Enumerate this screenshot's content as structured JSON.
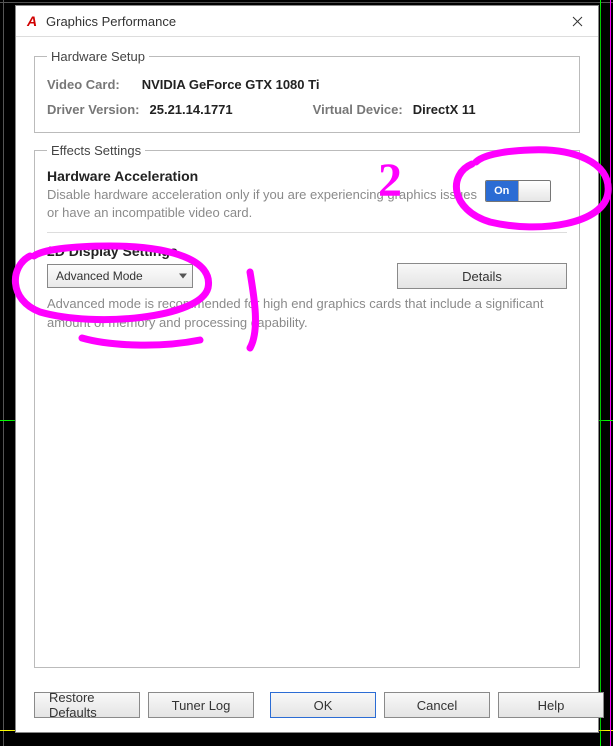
{
  "window": {
    "title": "Graphics Performance"
  },
  "hardware": {
    "legend": "Hardware Setup",
    "video_card_label": "Video Card:",
    "video_card_value": "NVIDIA GeForce GTX 1080 Ti",
    "driver_label": "Driver Version:",
    "driver_value": "25.21.14.1771",
    "virtual_device_label": "Virtual Device:",
    "virtual_device_value": "DirectX 11"
  },
  "effects": {
    "legend": "Effects Settings",
    "hw_accel_title": "Hardware Acceleration",
    "hw_accel_desc": "Disable hardware acceleration only if you are experiencing graphics issues or have an incompatible video card.",
    "toggle_on_label": "On",
    "twod_title": "2D Display Settings",
    "mode_selected": "Advanced Mode",
    "details_label": "Details",
    "twod_desc": "Advanced mode is recommended for high end graphics cards that include a significant amount of memory and processing capability."
  },
  "footer": {
    "restore": "Restore Defaults",
    "tuner": "Tuner Log",
    "ok": "OK",
    "cancel": "Cancel",
    "help": "Help"
  },
  "annotation": {
    "number": "2"
  },
  "colors": {
    "accent_blue": "#2b6cd4",
    "annotation_magenta": "#ff00ff"
  }
}
